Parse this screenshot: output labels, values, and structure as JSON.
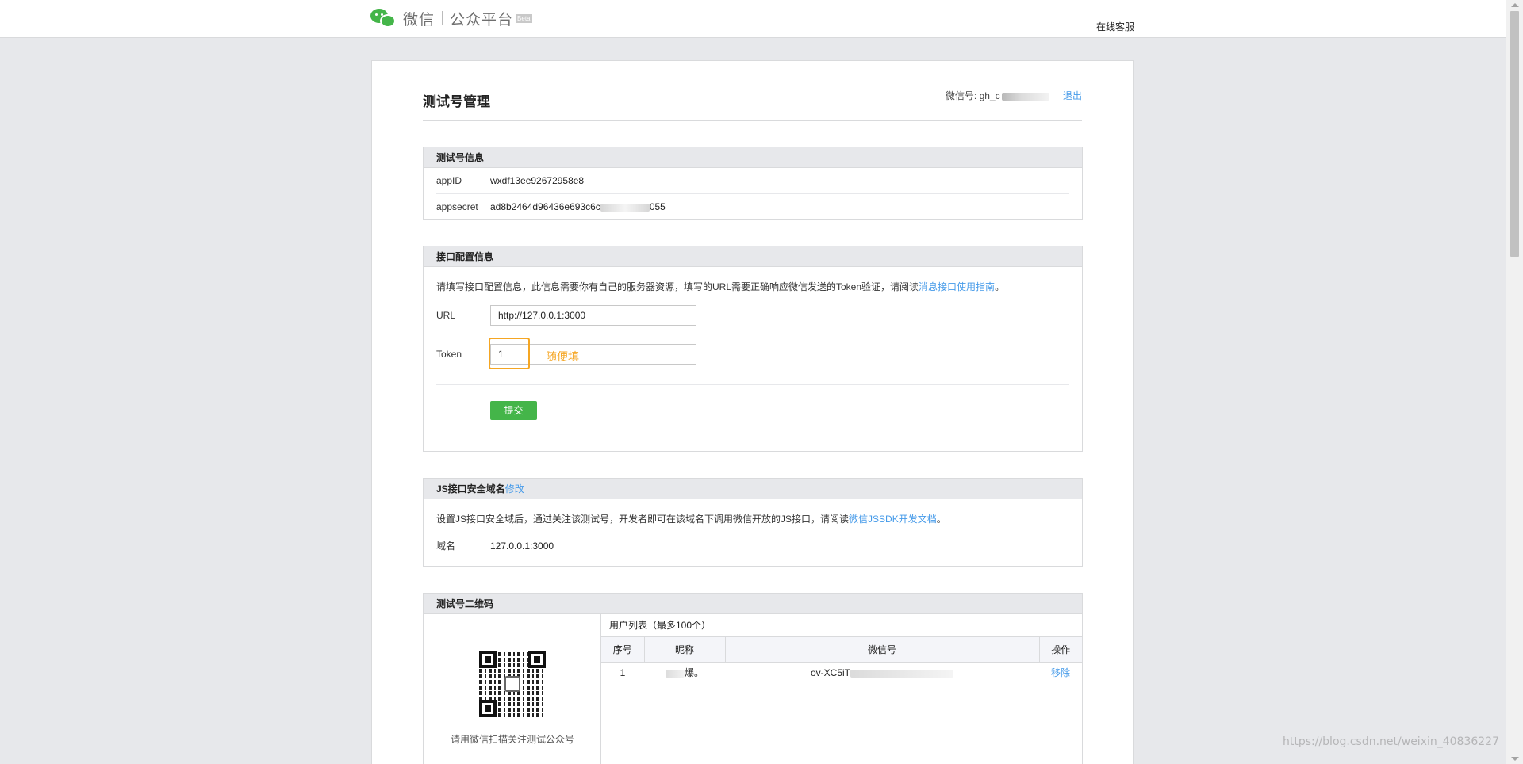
{
  "header": {
    "brand_wechat": "微信",
    "brand_platform": "公众平台",
    "beta": "Beta",
    "online_service": "在线客服"
  },
  "page": {
    "title": "测试号管理",
    "account_label": "微信号:",
    "account_value": "gh_c",
    "logout": "退出"
  },
  "test_info": {
    "heading": "测试号信息",
    "appid_label": "appID",
    "appid_value": "wxdf13ee92672958e8",
    "appsecret_label": "appsecret",
    "appsecret_prefix": "ad8b2464d96436e693c6c",
    "appsecret_suffix": "055"
  },
  "interface_config": {
    "heading": "接口配置信息",
    "description": "请填写接口配置信息，此信息需要你有自己的服务器资源，填写的URL需要正确响应微信发送的Token验证，请阅读",
    "guide_link": "消息接口使用指南",
    "period": "。",
    "url_label": "URL",
    "url_value": "http://127.0.0.1:3000",
    "token_label": "Token",
    "token_value": "1",
    "token_hint": "随便填",
    "submit": "提交"
  },
  "js_domain": {
    "heading": "JS接口安全域名",
    "edit_link": "修改",
    "description": "设置JS接口安全域后，通过关注该测试号，开发者即可在该域名下调用微信开放的JS接口，请阅读",
    "doc_link": "微信JSSDK开发文档",
    "period": "。",
    "domain_label": "域名",
    "domain_value": "127.0.0.1:3000"
  },
  "qrcode": {
    "heading": "测试号二维码",
    "caption": "请用微信扫描关注测试公众号",
    "user_list_title": "用户列表（最多100个）",
    "columns": [
      "序号",
      "昵称",
      "微信号",
      "操作"
    ],
    "rows": [
      {
        "index": "1",
        "nickname": "爆。",
        "wechat_id": "ov-XC5iT",
        "action": "移除"
      }
    ]
  },
  "watermark": "https://blog.csdn.net/weixin_40836227",
  "colors": {
    "brand_green": "#44b549",
    "link_blue": "#459ae9",
    "highlight_orange": "#f5a623"
  }
}
